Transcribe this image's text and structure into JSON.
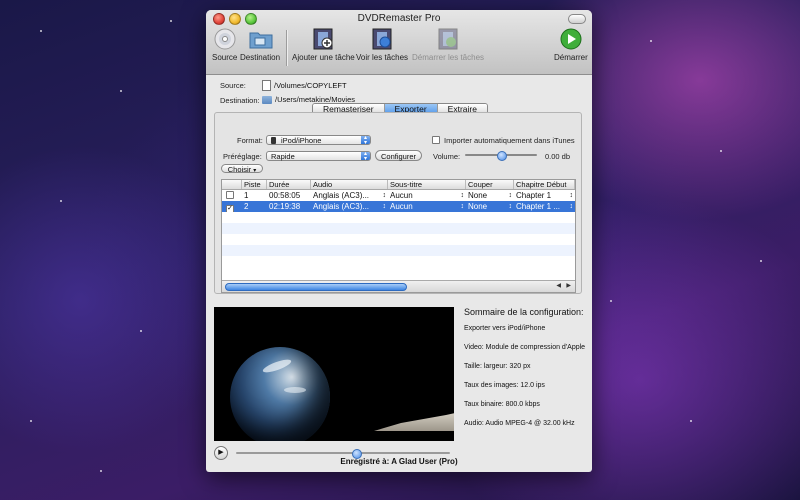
{
  "window": {
    "title": "DVDRemaster Pro"
  },
  "toolbar": {
    "source": "Source",
    "destination": "Destination",
    "add_task": "Ajouter une tâche",
    "view_tasks": "Voir les tâches",
    "start_tasks": "Démarrer les tâches",
    "start": "Démarrer"
  },
  "paths": {
    "source_label": "Source:",
    "source_value": "/Volumes/COPYLEFT",
    "destination_label": "Destination:",
    "destination_value": "/Users/metakine/Movies"
  },
  "tabs": [
    {
      "label": "Remasteriser",
      "active": false
    },
    {
      "label": "Exporter",
      "active": true
    },
    {
      "label": "Extraire",
      "active": false
    }
  ],
  "export": {
    "format_label": "Format:",
    "format_value": "iPod/iPhone",
    "itunes_label": "Importer automatiquement dans iTunes",
    "preset_label": "Préréglage:",
    "preset_value": "Rapide",
    "configure_label": "Configurer",
    "volume_label": "Volume:",
    "volume_value": "0.00 db",
    "choose_label": "Choisir"
  },
  "table": {
    "headers": [
      "",
      "Piste",
      "Durée",
      "Audio",
      "Sous-titre",
      "Couper",
      "Chapitre Début"
    ],
    "rows": [
      {
        "checked": false,
        "track": "1",
        "duration": "00:58:05",
        "audio": "Anglais (AC3)...",
        "subtitle": "Aucun",
        "cut": "None",
        "chapter": "Chapter 1"
      },
      {
        "checked": true,
        "track": "2",
        "duration": "02:19:38",
        "audio": "Anglais (AC3)...",
        "subtitle": "Aucun",
        "cut": "None",
        "chapter": "Chapter 1 ..."
      }
    ]
  },
  "summary": {
    "title": "Sommaire de la configuration:",
    "lines": [
      "Exporter vers iPod/iPhone",
      "Video: Module de compression d'Apple",
      "Taille: largeur: 320 px",
      "Taux des images: 12.0 ips",
      "Taux binaire: 800.0 kbps",
      "Audio: Audio MPEG-4 @ 32.00 kHz"
    ]
  },
  "playback": {
    "position": 0.56
  },
  "footer": {
    "registered": "Enregistré à: A Glad User (Pro)"
  }
}
